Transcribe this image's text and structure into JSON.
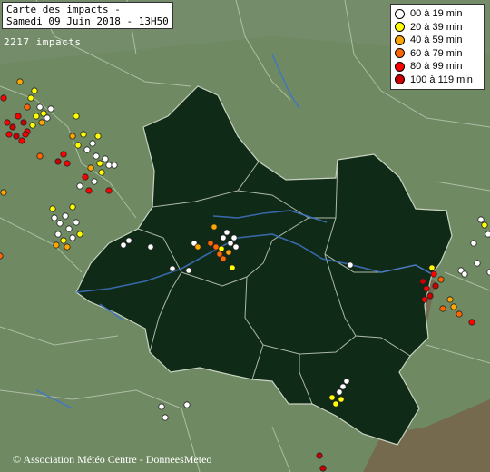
{
  "map": {
    "title_line1": "Carte des impacts -",
    "title_line2": "Samedi 09 Juin 2018 - 13H50",
    "impact_count": "2217 impacts",
    "credit": "© Association Météo Centre - DonneesMeteo",
    "colors": {
      "land": "#6f8a63",
      "region": "#0f2a16",
      "border": "#c9d2c0",
      "river": "#3f73c4",
      "relief": "#7a4e3e"
    }
  },
  "legend": {
    "items": [
      {
        "label": "00 à 19 min",
        "color": "#ffffff"
      },
      {
        "label": "20 à 39 min",
        "color": "#ffff00"
      },
      {
        "label": "40 à 59 min",
        "color": "#ffa500"
      },
      {
        "label": "60 à 79 min",
        "color": "#ff6600"
      },
      {
        "label": "80 à 99 min",
        "color": "#ff0000"
      },
      {
        "label": "100 à 119 min",
        "color": "#cc0000"
      }
    ]
  }
}
